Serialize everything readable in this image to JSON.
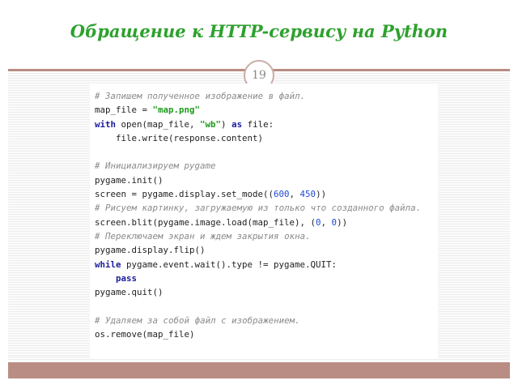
{
  "slide": {
    "title": "Обращение к HTTP-сервису на Python",
    "page_number": "19",
    "accent_color": "#b98d83",
    "title_color": "#2ea12e"
  },
  "code": {
    "lines": [
      [
        {
          "t": "# ",
          "c": "com"
        },
        {
          "t": "Запишем",
          "c": "com",
          "u": 1
        },
        {
          "t": " ",
          "c": "com"
        },
        {
          "t": "полученное",
          "c": "com",
          "u": 1
        },
        {
          "t": " ",
          "c": "com"
        },
        {
          "t": "изображение",
          "c": "com",
          "u": 1
        },
        {
          "t": " в ",
          "c": "com"
        },
        {
          "t": "файл",
          "c": "com",
          "u": 1
        },
        {
          "t": ".",
          "c": "com"
        }
      ],
      [
        {
          "t": "map_file = ",
          "c": "plain"
        },
        {
          "t": "\"map.png\"",
          "c": "str"
        }
      ],
      [
        {
          "t": "with",
          "c": "kw"
        },
        {
          "t": " open(map_file, ",
          "c": "plain"
        },
        {
          "t": "\"wb\"",
          "c": "str"
        },
        {
          "t": ") ",
          "c": "plain"
        },
        {
          "t": "as",
          "c": "kw"
        },
        {
          "t": " file:",
          "c": "plain"
        }
      ],
      [
        {
          "t": "    file.write(response.content)",
          "c": "plain"
        }
      ],
      [],
      [
        {
          "t": "# ",
          "c": "com"
        },
        {
          "t": "Инициализируем",
          "c": "com",
          "u": 1
        },
        {
          "t": " pygame",
          "c": "com"
        }
      ],
      [
        {
          "t": "pygame.init()",
          "c": "plain"
        }
      ],
      [
        {
          "t": "screen = pygame.display.set_mode((",
          "c": "plain"
        },
        {
          "t": "600",
          "c": "num"
        },
        {
          "t": ", ",
          "c": "plain"
        },
        {
          "t": "450",
          "c": "num"
        },
        {
          "t": "))",
          "c": "plain"
        }
      ],
      [
        {
          "t": "# ",
          "c": "com"
        },
        {
          "t": "Рисуем",
          "c": "com",
          "u": 1
        },
        {
          "t": " ",
          "c": "com"
        },
        {
          "t": "картинку",
          "c": "com",
          "u": 1
        },
        {
          "t": ", ",
          "c": "com"
        },
        {
          "t": "загружаемую",
          "c": "com",
          "u": 1
        },
        {
          "t": " из ",
          "c": "com"
        },
        {
          "t": "только",
          "c": "com",
          "u": 1
        },
        {
          "t": " что ",
          "c": "com"
        },
        {
          "t": "созданного",
          "c": "com",
          "u": 1
        },
        {
          "t": " ",
          "c": "com"
        },
        {
          "t": "файла",
          "c": "com",
          "u": 1
        },
        {
          "t": ".",
          "c": "com"
        }
      ],
      [
        {
          "t": "screen.blit(pygame.image.load(map_file), (",
          "c": "plain"
        },
        {
          "t": "0",
          "c": "num"
        },
        {
          "t": ", ",
          "c": "plain"
        },
        {
          "t": "0",
          "c": "num"
        },
        {
          "t": "))",
          "c": "plain"
        }
      ],
      [
        {
          "t": "# ",
          "c": "com"
        },
        {
          "t": "Переключаем",
          "c": "com",
          "u": 1
        },
        {
          "t": " экран и ждем ",
          "c": "com"
        },
        {
          "t": "закрытия",
          "c": "com",
          "u": 1
        },
        {
          "t": " окна.",
          "c": "com"
        }
      ],
      [
        {
          "t": "pygame.display.flip()",
          "c": "plain"
        }
      ],
      [
        {
          "t": "while",
          "c": "kw"
        },
        {
          "t": " pygame.event.wait().type != pygame.QUIT:",
          "c": "plain"
        }
      ],
      [
        {
          "t": "    ",
          "c": "plain"
        },
        {
          "t": "pass",
          "c": "kw"
        }
      ],
      [
        {
          "t": "pygame.quit()",
          "c": "plain"
        }
      ],
      [],
      [
        {
          "t": "# ",
          "c": "com"
        },
        {
          "t": "Удаляем",
          "c": "com",
          "u": 1
        },
        {
          "t": " за ",
          "c": "com"
        },
        {
          "t": "собой",
          "c": "com"
        },
        {
          "t": " ",
          "c": "com"
        },
        {
          "t": "файл",
          "c": "com"
        },
        {
          "t": " с ",
          "c": "com"
        },
        {
          "t": "изображением",
          "c": "com",
          "u": 1
        },
        {
          "t": ".",
          "c": "com"
        }
      ],
      [
        {
          "t": "os.remove(map_file)",
          "c": "plain"
        }
      ]
    ]
  }
}
